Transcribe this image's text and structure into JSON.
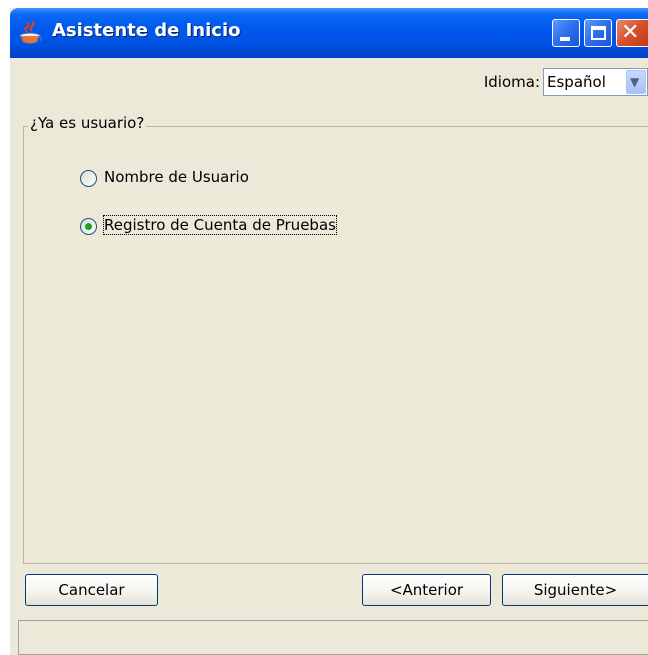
{
  "window": {
    "title": "Asistente de Inicio"
  },
  "language": {
    "label": "Idioma:",
    "selected": "Español"
  },
  "group": {
    "title": "¿Ya es usuario?"
  },
  "options": [
    {
      "label": "Nombre de Usuario",
      "selected": false
    },
    {
      "label": "Registro de Cuenta de Pruebas",
      "selected": true
    }
  ],
  "buttons": {
    "cancel": "Cancelar",
    "previous": "<Anterior",
    "next": "Siguiente>"
  },
  "colors": {
    "titlebar": "#0054e3",
    "window_bg": "#ece9d8",
    "radio_dot": "#21a121"
  },
  "icons": {
    "app": "java-coffee-cup-icon",
    "minimize": "minimize-icon",
    "maximize": "maximize-icon",
    "close": "close-icon",
    "dropdown": "chevron-down-icon"
  }
}
